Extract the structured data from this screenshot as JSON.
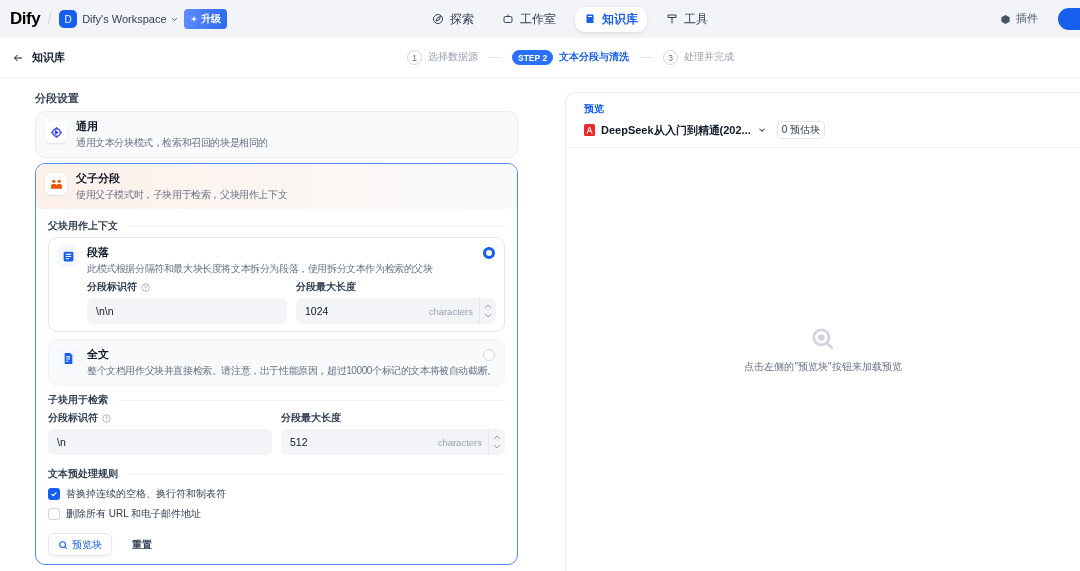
{
  "nav": {
    "logo": "Dify",
    "workspace_initial": "D",
    "workspace": "Dify's Workspace",
    "upgrade": "升级",
    "tabs": [
      {
        "label": "探索",
        "selected": false
      },
      {
        "label": "工作室",
        "selected": false
      },
      {
        "label": "知识库",
        "selected": true
      },
      {
        "label": "工具",
        "selected": false
      }
    ],
    "plugins": "插件"
  },
  "header": {
    "back": "知识库",
    "steps": [
      {
        "marker": "1",
        "label": "选择数据源",
        "selected": false
      },
      {
        "marker": "STEP 2",
        "label": "文本分段与清洗",
        "selected": true
      },
      {
        "marker": "3",
        "label": "处理并完成",
        "selected": false
      }
    ]
  },
  "segmentation": {
    "title": "分段设置",
    "modes": [
      {
        "title": "通用",
        "description": "通用文本分块模式，检索和召回的块是相同的",
        "selected": false
      },
      {
        "title": "父子分段",
        "description": "使用父子模式时，子块用于检索，父块用作上下文",
        "selected": true
      }
    ],
    "parent": {
      "title": "父块用作上下文",
      "options": [
        {
          "title": "段落",
          "description": "此模式根据分隔符和最大块长度将文本拆分为段落，使用拆分文本作为检索的父块",
          "selected": true,
          "fields": [
            {
              "label": "分段标识符",
              "help": true,
              "value": "\\n\\n",
              "kind": "text"
            },
            {
              "label": "分段最大长度",
              "help": false,
              "value": "1024",
              "unit": "characters",
              "kind": "number"
            }
          ]
        },
        {
          "title": "全文",
          "description": "整个文档用作父块并直接检索。请注意，出于性能原因，超过10000个标记的文本将被自动截断。",
          "selected": false
        }
      ]
    },
    "child": {
      "title": "子块用于检索",
      "fields": [
        {
          "label": "分段标识符",
          "help": true,
          "value": "\\n",
          "kind": "text"
        },
        {
          "label": "分段最大长度",
          "help": false,
          "value": "512",
          "unit": "characters",
          "kind": "number"
        }
      ]
    },
    "rules": {
      "title": "文本预处理规则",
      "items": [
        {
          "label": "替换掉连续的空格、换行符和制表符",
          "checked": true
        },
        {
          "label": "删除所有 URL 和电子邮件地址",
          "checked": false
        }
      ]
    },
    "buttons": [
      {
        "label": "预览块",
        "kind": "primary"
      },
      {
        "label": "重置",
        "kind": "plain"
      }
    ]
  },
  "preview": {
    "label": "预览",
    "file": "DeepSeek从入门到精通(202...",
    "count": "0 预估块",
    "empty": "点击左侧的\"预览块\"按钮来加载预览"
  }
}
